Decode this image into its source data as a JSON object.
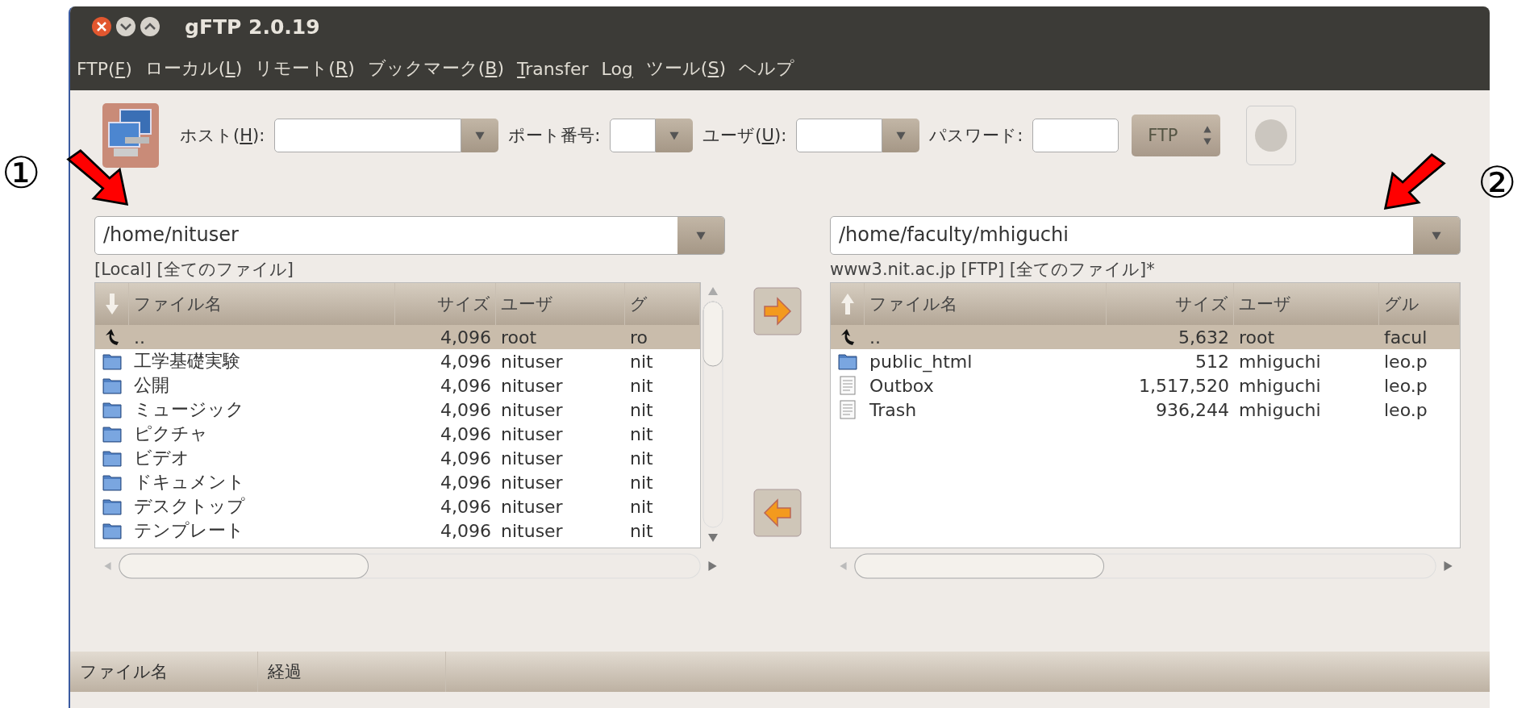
{
  "annotations": [
    {
      "label": "①"
    },
    {
      "label": "②"
    }
  ],
  "window": {
    "title": "gFTP 2.0.19"
  },
  "menu": [
    {
      "text": "FTP(",
      "key": "F",
      "after": ")"
    },
    {
      "text": "ローカル(",
      "key": "L",
      "after": ")"
    },
    {
      "text": "リモート(",
      "key": "R",
      "after": ")"
    },
    {
      "text": "ブックマーク(",
      "key": "B",
      "after": ")"
    },
    {
      "key": "T",
      "after": "ransfer"
    },
    {
      "text": "Lo",
      "key": "g"
    },
    {
      "text": "ツール(",
      "key": "S",
      "after": ")"
    },
    {
      "text": "ヘルプ"
    }
  ],
  "toolbar": {
    "fields": [
      {
        "text": "ホスト(",
        "key": "H",
        "after": "):",
        "kind": "combo"
      },
      {
        "text": "ポート番号:",
        "kind": "combo"
      },
      {
        "text": "ユーザ(",
        "key": "U",
        "after": "):",
        "kind": "combo"
      },
      {
        "text": "パスワード:",
        "kind": "entry"
      }
    ],
    "protocol": "FTP"
  },
  "panes": [
    {
      "path": "/home/nituser",
      "label": "[Local] [全てのファイル]",
      "columns": [
        "ファイル名",
        "サイズ",
        "ユーザ",
        "グ"
      ],
      "rows": [
        {
          "kind": "up",
          "selected": true,
          "name": "..",
          "size": "4,096",
          "user": "root",
          "group": "ro"
        },
        {
          "kind": "folder",
          "selected": false,
          "name": "工学基礎実験",
          "size": "4,096",
          "user": "nituser",
          "group": "nit"
        },
        {
          "kind": "folder",
          "selected": false,
          "name": "公開",
          "size": "4,096",
          "user": "nituser",
          "group": "nit"
        },
        {
          "kind": "folder",
          "selected": false,
          "name": "ミュージック",
          "size": "4,096",
          "user": "nituser",
          "group": "nit"
        },
        {
          "kind": "folder",
          "selected": false,
          "name": "ピクチャ",
          "size": "4,096",
          "user": "nituser",
          "group": "nit"
        },
        {
          "kind": "folder",
          "selected": false,
          "name": "ビデオ",
          "size": "4,096",
          "user": "nituser",
          "group": "nit"
        },
        {
          "kind": "folder",
          "selected": false,
          "name": "ドキュメント",
          "size": "4,096",
          "user": "nituser",
          "group": "nit"
        },
        {
          "kind": "folder",
          "selected": false,
          "name": "デスクトップ",
          "size": "4,096",
          "user": "nituser",
          "group": "nit"
        },
        {
          "kind": "folder",
          "selected": false,
          "name": "テンプレート",
          "size": "4,096",
          "user": "nituser",
          "group": "nit"
        }
      ]
    },
    {
      "path": "/home/faculty/mhiguchi",
      "label": "www3.nit.ac.jp [FTP] [全てのファイル]*",
      "columns": [
        "ファイル名",
        "サイズ",
        "ユーザ",
        "グル"
      ],
      "rows": [
        {
          "kind": "up",
          "selected": true,
          "name": "..",
          "size": "5,632",
          "user": "root",
          "group": "facul"
        },
        {
          "kind": "folder",
          "selected": false,
          "name": "public_html",
          "size": "512",
          "user": "mhiguchi",
          "group": "leo.p"
        },
        {
          "kind": "file",
          "selected": false,
          "name": "Outbox",
          "size": "1,517,520",
          "user": "mhiguchi",
          "group": "leo.p"
        },
        {
          "kind": "file",
          "selected": false,
          "name": "Trash",
          "size": "936,244",
          "user": "mhiguchi",
          "group": "leo.p"
        }
      ]
    }
  ],
  "transfer_buttons": [
    {
      "kind": "right"
    },
    {
      "kind": "left"
    }
  ],
  "queue": {
    "columns": [
      "ファイル名",
      "経過"
    ]
  }
}
